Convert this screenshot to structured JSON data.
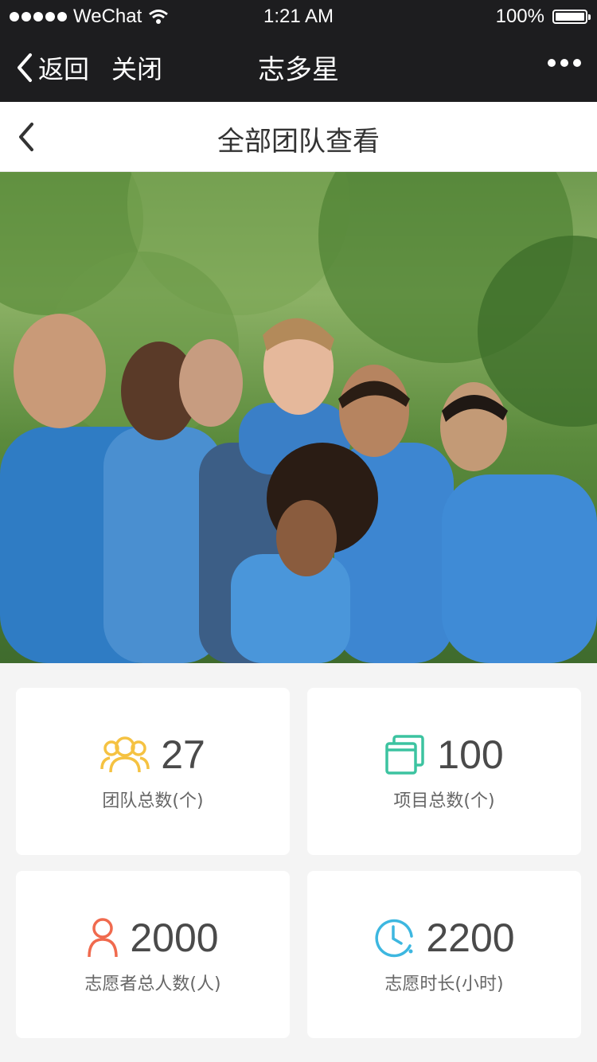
{
  "status": {
    "carrier": "WeChat",
    "time": "1:21 AM",
    "battery": "100%"
  },
  "wechat_nav": {
    "back_label": "返回",
    "close_label": "关闭",
    "title": "志多星"
  },
  "header": {
    "title": "全部团队查看"
  },
  "stats": [
    {
      "icon": "group-icon",
      "value": "27",
      "label": "团队总数(个)",
      "color": "#f5c242"
    },
    {
      "icon": "projects-icon",
      "value": "100",
      "label": "项目总数(个)",
      "color": "#3cc3a0"
    },
    {
      "icon": "person-icon",
      "value": "2000",
      "label": "志愿者总人数(人)",
      "color": "#f06a4e"
    },
    {
      "icon": "clock-icon",
      "value": "2200",
      "label": "志愿时长(小时)",
      "color": "#3db7e0"
    }
  ]
}
